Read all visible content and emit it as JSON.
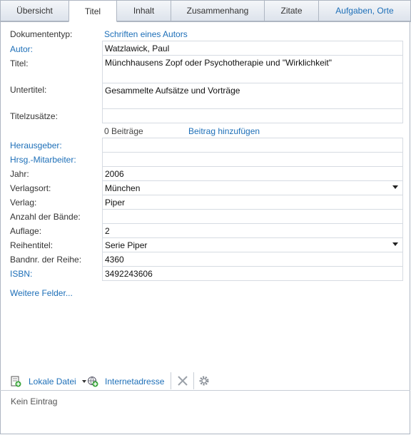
{
  "tabs": [
    {
      "label": "Übersicht"
    },
    {
      "label": "Titel"
    },
    {
      "label": "Inhalt"
    },
    {
      "label": "Zusammenhang"
    },
    {
      "label": "Zitate"
    },
    {
      "label": "Aufgaben, Orte"
    }
  ],
  "doc_type": {
    "label": "Dokumententyp:",
    "value": "Schriften eines Autors"
  },
  "fields": {
    "autor": {
      "label": "Autor:",
      "value": "Watzlawick, Paul"
    },
    "titel": {
      "label": "Titel:",
      "value": "Münchhausens Zopf oder Psychotherapie und \"Wirklichkeit\""
    },
    "untertitel": {
      "label": "Untertitel:",
      "value": "Gesammelte Aufsätze und Vorträge"
    },
    "titelzusaetze": {
      "label": "Titelzusätze:",
      "value": ""
    },
    "herausgeber": {
      "label": "Herausgeber:",
      "value": ""
    },
    "hrsg_mitarbeiter": {
      "label": "Hrsg.-Mitarbeiter:",
      "value": ""
    },
    "jahr": {
      "label": "Jahr:",
      "value": "2006"
    },
    "verlagsort": {
      "label": "Verlagsort:",
      "value": "München"
    },
    "verlag": {
      "label": "Verlag:",
      "value": "Piper"
    },
    "anzahl_baende": {
      "label": "Anzahl der Bände:",
      "value": ""
    },
    "auflage": {
      "label": "Auflage:",
      "value": "2"
    },
    "reihentitel": {
      "label": "Reihentitel:",
      "value": "Serie Piper"
    },
    "bandnr": {
      "label": "Bandnr. der Reihe:",
      "value": "4360"
    },
    "isbn": {
      "label": "ISBN:",
      "value": "3492243606"
    }
  },
  "beitraege": {
    "count": "0 Beiträge",
    "add": "Beitrag hinzufügen"
  },
  "more_fields": "Weitere Felder...",
  "toolbar": {
    "local_file": "Lokale Datei",
    "internet": "Internetadresse"
  },
  "attachments_empty": "Kein Eintrag",
  "colors": {
    "link": "#1d6fb8",
    "border": "#aeb6c2"
  }
}
